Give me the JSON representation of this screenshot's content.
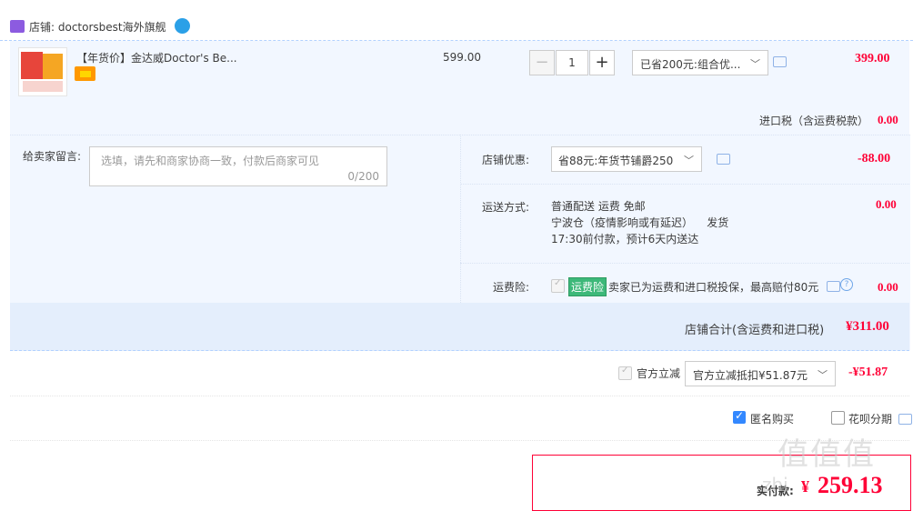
{
  "store": {
    "label": "店铺: doctorsbest海外旗舰"
  },
  "item": {
    "title": "【年货价】金达威Doctor's Be...",
    "unit_price": "599.00",
    "quantity": "1",
    "qty_minus": "−",
    "qty_plus": "+",
    "promo_selected": "已省200元:组合优...",
    "total": "399.00"
  },
  "tax": {
    "label": "进口税（含运费税款）",
    "value": "0.00"
  },
  "message": {
    "label": "给卖家留言:",
    "placeholder": "选填，请先和商家协商一致，付款后商家可见",
    "count": "0/200"
  },
  "shop_coupon": {
    "label": "店铺优惠:",
    "selected": "省88元:年货节铺爵250",
    "value": "-88.00"
  },
  "shipping": {
    "label": "运送方式:",
    "method": "普通配送 运费 免邮",
    "warehouse": "宁波仓（疫情影响或有延迟）",
    "dispatch": "发货",
    "eta": "17:30前付款，预计6天内送达",
    "value": "0.00"
  },
  "insurance": {
    "label": "运费险:",
    "badge": "运费险",
    "text": "卖家已为运费和进口税投保，最高赔付80元",
    "help": "?",
    "value": "0.00"
  },
  "store_total": {
    "label": "店铺合计(含运费和进口税)",
    "value": "¥311.00"
  },
  "official_discount": {
    "label": "官方立减",
    "selected": "官方立减抵扣¥51.87元",
    "value": "-¥51.87"
  },
  "options": {
    "anonymous": "匿名购买",
    "huabei": "花呗分期"
  },
  "payment": {
    "label": "实付款:",
    "currency": "¥",
    "value": "259.13"
  },
  "watermark": {
    "text": "值值值",
    "sub": "zhi"
  },
  "colors": {
    "accent_red": "#ff0036",
    "panel_bg": "#f2f7ff",
    "checkbox_blue": "#3388ff",
    "insurance_green": "#3db879"
  },
  "icons": [
    "shop-icon",
    "wangwang-chat-icon",
    "message-icon",
    "chevron-down-icon",
    "help-icon",
    "checkbox-icon"
  ]
}
